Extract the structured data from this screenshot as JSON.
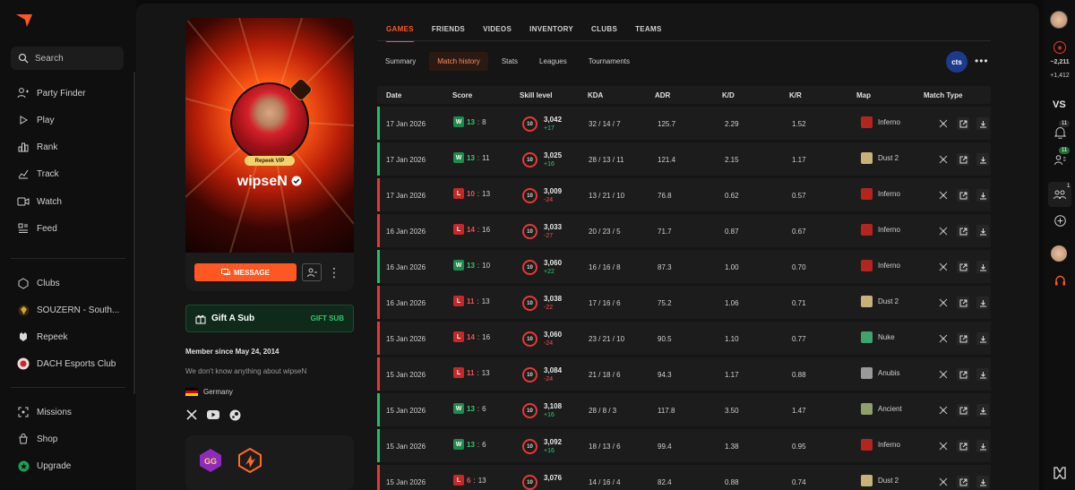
{
  "sidebar": {
    "search_label": "Search",
    "items": [
      {
        "label": "Party Finder",
        "icon": "party-finder-icon"
      },
      {
        "label": "Play",
        "icon": "play-icon"
      },
      {
        "label": "Rank",
        "icon": "rank-icon"
      },
      {
        "label": "Track",
        "icon": "track-icon"
      },
      {
        "label": "Watch",
        "icon": "watch-icon"
      },
      {
        "label": "Feed",
        "icon": "feed-icon"
      }
    ],
    "clubs": [
      {
        "label": "Clubs"
      },
      {
        "label": "SOUZERN - South..."
      },
      {
        "label": "Repeek"
      },
      {
        "label": "DACH Esports Club"
      }
    ],
    "bottom": [
      {
        "label": "Missions"
      },
      {
        "label": "Shop"
      },
      {
        "label": "Upgrade"
      }
    ]
  },
  "profile": {
    "vip_label": "Repeek VIP",
    "nickname": "wipseN",
    "message_button": "MESSAGE",
    "gift_label": "Gift A Sub",
    "gift_button": "GIFT SUB",
    "member_since": "Member since May 24, 2014",
    "about": "We don't know anything about wipseN",
    "country": "Germany"
  },
  "tabs": [
    "GAMES",
    "FRIENDS",
    "VIDEOS",
    "INVENTORY",
    "CLUBS",
    "TEAMS"
  ],
  "active_tab": "GAMES",
  "subtabs": [
    "Summary",
    "Match history",
    "Stats",
    "Leagues",
    "Tournaments"
  ],
  "active_subtab": "Match history",
  "partner_logo_text": "cts",
  "table": {
    "headers": {
      "date": "Date",
      "score": "Score",
      "skill": "Skill level",
      "kda": "KDA",
      "adr": "ADR",
      "kd": "K/D",
      "kr": "K/R",
      "map": "Map",
      "type": "Match Type"
    },
    "rows": [
      {
        "date": "17 Jan 2026",
        "result": "W",
        "s1": "13",
        "s2": "8",
        "level": "10",
        "elo": "3,042",
        "delta": "+17",
        "kda": "32 / 14 / 7",
        "adr": "125.7",
        "kd": "2.29",
        "kr": "1.52",
        "map": "Inferno"
      },
      {
        "date": "17 Jan 2026",
        "result": "W",
        "s1": "13",
        "s2": "11",
        "level": "10",
        "elo": "3,025",
        "delta": "+16",
        "kda": "28 / 13 / 11",
        "adr": "121.4",
        "kd": "2.15",
        "kr": "1.17",
        "map": "Dust 2"
      },
      {
        "date": "17 Jan 2026",
        "result": "L",
        "s1": "10",
        "s2": "13",
        "level": "10",
        "elo": "3,009",
        "delta": "-24",
        "kda": "13 / 21 / 10",
        "adr": "76.8",
        "kd": "0.62",
        "kr": "0.57",
        "map": "Inferno"
      },
      {
        "date": "16 Jan 2026",
        "result": "L",
        "s1": "14",
        "s2": "16",
        "level": "10",
        "elo": "3,033",
        "delta": "-27",
        "kda": "20 / 23 / 5",
        "adr": "71.7",
        "kd": "0.87",
        "kr": "0.67",
        "map": "Inferno"
      },
      {
        "date": "16 Jan 2026",
        "result": "W",
        "s1": "13",
        "s2": "10",
        "level": "10",
        "elo": "3,060",
        "delta": "+22",
        "kda": "16 / 16 / 8",
        "adr": "87.3",
        "kd": "1.00",
        "kr": "0.70",
        "map": "Inferno"
      },
      {
        "date": "16 Jan 2026",
        "result": "L",
        "s1": "11",
        "s2": "13",
        "level": "10",
        "elo": "3,038",
        "delta": "-22",
        "kda": "17 / 16 / 6",
        "adr": "75.2",
        "kd": "1.06",
        "kr": "0.71",
        "map": "Dust 2"
      },
      {
        "date": "15 Jan 2026",
        "result": "L",
        "s1": "14",
        "s2": "16",
        "level": "10",
        "elo": "3,060",
        "delta": "-24",
        "kda": "23 / 21 / 10",
        "adr": "90.5",
        "kd": "1.10",
        "kr": "0.77",
        "map": "Nuke"
      },
      {
        "date": "15 Jan 2026",
        "result": "L",
        "s1": "11",
        "s2": "13",
        "level": "10",
        "elo": "3,084",
        "delta": "-24",
        "kda": "21 / 18 / 6",
        "adr": "94.3",
        "kd": "1.17",
        "kr": "0.88",
        "map": "Anubis"
      },
      {
        "date": "15 Jan 2026",
        "result": "W",
        "s1": "13",
        "s2": "6",
        "level": "10",
        "elo": "3,108",
        "delta": "+16",
        "kda": "28 / 8 / 3",
        "adr": "117.8",
        "kd": "3.50",
        "kr": "1.47",
        "map": "Ancient"
      },
      {
        "date": "15 Jan 2026",
        "result": "W",
        "s1": "13",
        "s2": "6",
        "level": "10",
        "elo": "3,092",
        "delta": "+16",
        "kda": "18 / 13 / 6",
        "adr": "99.4",
        "kd": "1.38",
        "kr": "0.95",
        "map": "Inferno"
      },
      {
        "date": "15 Jan 2026",
        "result": "L",
        "s1": "6",
        "s2": "13",
        "level": "10",
        "elo": "3,076",
        "delta": "",
        "kda": "14 / 16 / 4",
        "adr": "82.4",
        "kd": "0.88",
        "kr": "0.74",
        "map": "Dust 2"
      }
    ]
  },
  "rightbar": {
    "stat1": "~2,211",
    "stat2": "+1,412",
    "vs_label": "VS",
    "notif_count": "11",
    "friends_count": "11",
    "party_count": "1"
  },
  "colors": {
    "accent": "#ff5722",
    "win": "#21c06a",
    "loss": "#e53935"
  }
}
